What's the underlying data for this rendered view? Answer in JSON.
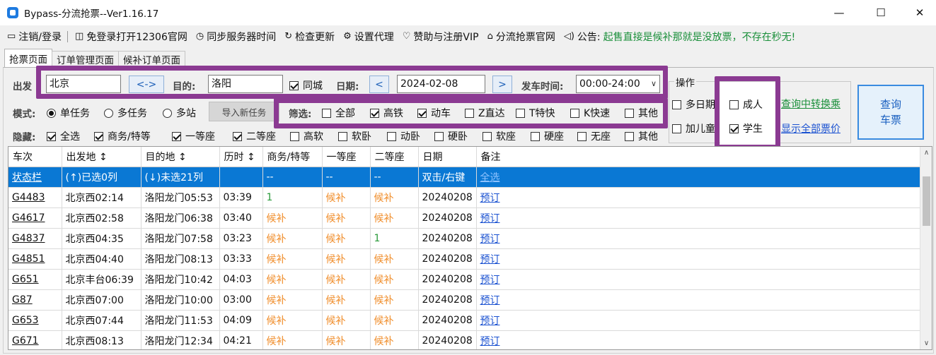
{
  "window": {
    "title": "Bypass-分流抢票--Ver1.16.17",
    "minimize": "—",
    "maximize": "☐",
    "close": "✕"
  },
  "menu": {
    "logout": "注销/登录",
    "login_free": "免登录打开12306官网",
    "sync_time": "同步服务器时间",
    "check_update": "检查更新",
    "proxy": "设置代理",
    "sponsor": "赞助与注册VIP",
    "homepage": "分流抢票官网",
    "notice_label": "公告:",
    "notice_text": "起售直接是候补那就是没放票，不存在秒无!"
  },
  "tabs": [
    "抢票页面",
    "订单管理页面",
    "候补订单页面"
  ],
  "form": {
    "from_label": "出发",
    "from_value": "北京",
    "swap_label": "<->",
    "to_label": "目的:",
    "to_value": "洛阳",
    "same_city_label": "同城",
    "date_label": "日期:",
    "date_prev": "<",
    "date_value": "2024-02-08",
    "date_next": ">",
    "depart_time_label": "发车时间:",
    "depart_time_value": "00:00-24:00",
    "mode_label": "模式:",
    "mode_single": "单任务",
    "mode_multi": "多任务",
    "mode_station": "多站",
    "import_btn": "导入新任务",
    "filter_label": "筛选:",
    "filters": [
      {
        "label": "全部",
        "checked": false
      },
      {
        "label": "高铁",
        "checked": true
      },
      {
        "label": "动车",
        "checked": true
      },
      {
        "label": "Z直达",
        "checked": false
      },
      {
        "label": "T特快",
        "checked": false
      },
      {
        "label": "K快速",
        "checked": false
      },
      {
        "label": "其他",
        "checked": false
      }
    ],
    "hide_label": "隐藏:",
    "hides": [
      {
        "label": "全选",
        "checked": true
      },
      {
        "label": "商务/特等",
        "checked": true
      },
      {
        "label": "一等座",
        "checked": true
      },
      {
        "label": "二等座",
        "checked": true
      },
      {
        "label": "高软",
        "checked": false
      },
      {
        "label": "软卧",
        "checked": false
      },
      {
        "label": "动卧",
        "checked": false
      },
      {
        "label": "硬卧",
        "checked": false
      },
      {
        "label": "软座",
        "checked": false
      },
      {
        "label": "硬座",
        "checked": false
      },
      {
        "label": "无座",
        "checked": false
      },
      {
        "label": "其他",
        "checked": false
      }
    ],
    "ops_label": "操作",
    "multi_day": "多日期",
    "add_child": "加儿童",
    "adult": "成人",
    "student": "学生",
    "transfer_link": "查询中转换乘",
    "all_price_link": "显示全部票价",
    "query_btn_line1": "查询",
    "query_btn_line2": "车票"
  },
  "table": {
    "headers": [
      "车次",
      "出发地 ↕",
      "目的地 ↕",
      "历时 ↕",
      "商务/特等",
      "一等座",
      "二等座",
      "日期",
      "备注"
    ],
    "status_row": [
      "状态栏",
      "(↑)已选0列",
      "(↓)未选21列",
      "",
      "--",
      "--",
      "--",
      "双击/右键",
      "全选"
    ],
    "rows": [
      [
        "G4483",
        "北京西02:14",
        "洛阳龙门05:53",
        "03:39",
        "1",
        "候补",
        "候补",
        "20240208",
        "预订"
      ],
      [
        "G4617",
        "北京西02:58",
        "洛阳龙门06:38",
        "03:40",
        "候补",
        "候补",
        "候补",
        "20240208",
        "预订"
      ],
      [
        "G4837",
        "北京西04:35",
        "洛阳龙门07:58",
        "03:23",
        "候补",
        "候补",
        "1",
        "20240208",
        "预订"
      ],
      [
        "G4851",
        "北京西04:40",
        "洛阳龙门08:13",
        "03:33",
        "候补",
        "候补",
        "候补",
        "20240208",
        "预订"
      ],
      [
        "G651",
        "北京丰台06:39",
        "洛阳龙门10:42",
        "04:03",
        "候补",
        "候补",
        "候补",
        "20240208",
        "预订"
      ],
      [
        "G87",
        "北京西07:00",
        "洛阳龙门10:00",
        "03:00",
        "候补",
        "候补",
        "候补",
        "20240208",
        "预订"
      ],
      [
        "G653",
        "北京西07:44",
        "洛阳龙门11:53",
        "04:09",
        "候补",
        "候补",
        "候补",
        "20240208",
        "预订"
      ],
      [
        "G671",
        "北京西08:13",
        "洛阳龙门12:34",
        "04:21",
        "候补",
        "候补",
        "候补",
        "20240208",
        "预订"
      ]
    ]
  },
  "colors": {
    "highlight": "#8b3a92",
    "waitlist": "#f08c28",
    "available": "#2a9a3a",
    "selected_row": "#0a78d4",
    "link": "#1b52d1",
    "green_link": "#1a8f3a"
  }
}
